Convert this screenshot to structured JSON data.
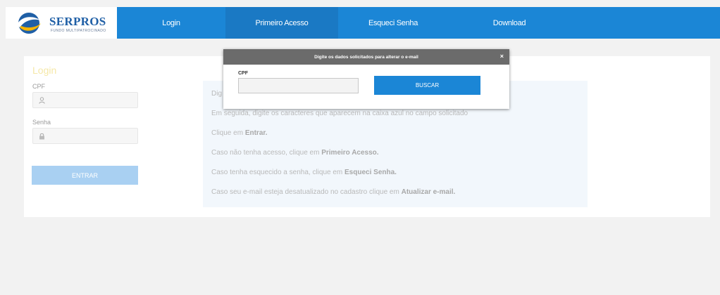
{
  "brand": {
    "name": "SERPROS",
    "tagline": "FUNDO MULTIPATROCINADO",
    "color_blue": "#1b86d6",
    "logo_accent": "#f5b400"
  },
  "nav": {
    "items": [
      {
        "label": "Login"
      },
      {
        "label": "Primeiro Acesso"
      },
      {
        "label": "Esqueci Senha"
      },
      {
        "label": "Download"
      }
    ]
  },
  "login": {
    "title": "Login",
    "cpf_label": "CPF",
    "senha_label": "Senha",
    "submit_label": "ENTRAR"
  },
  "instructions": {
    "l1": "Dig",
    "l2": "Em seguida, digite os caracteres que aparecem na caixa azul no campo solicitado",
    "l3a": "Clique em ",
    "l3b": "Entrar.",
    "l4a": "Caso não tenha acesso, clique em ",
    "l4b": "Primeiro Acesso.",
    "l5a": "Caso tenha esquecido a senha, clique em ",
    "l5b": "Esqueci Senha.",
    "l6a": "Caso seu e-mail esteja desatualizado no cadastro clique em ",
    "l6b": "Atualizar e-mail."
  },
  "modal": {
    "title": "Digite os dados solicitados para alterar o e-mail",
    "close": "×",
    "cpf_label": "CPF",
    "cpf_value": "",
    "button_label": "BUSCAR"
  }
}
